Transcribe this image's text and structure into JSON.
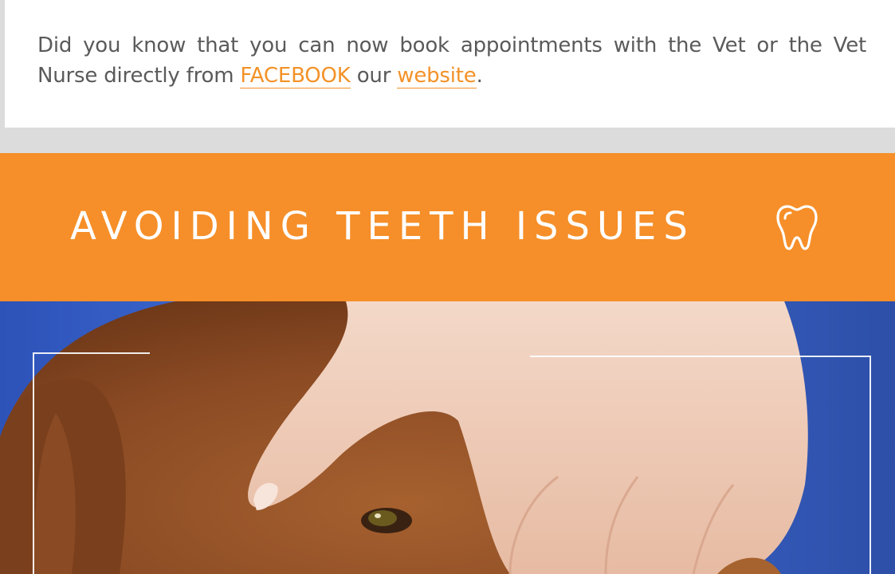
{
  "notice": {
    "text_before": "Did you know that you can now book appointments with the Vet or the Vet Nurse directly from ",
    "facebook_link": "FACEBOOK",
    "text_middle": " our ",
    "website_link": "website",
    "text_after": "."
  },
  "banner": {
    "title": "AVOIDING TEETH ISSUES",
    "icon": "tooth-icon"
  },
  "photo": {
    "subject": "dog-with-hand-on-head"
  },
  "colors": {
    "accent": "#f68f29",
    "link": "#f39228",
    "text": "#5a5a5a",
    "background": "#dcdcdc"
  }
}
